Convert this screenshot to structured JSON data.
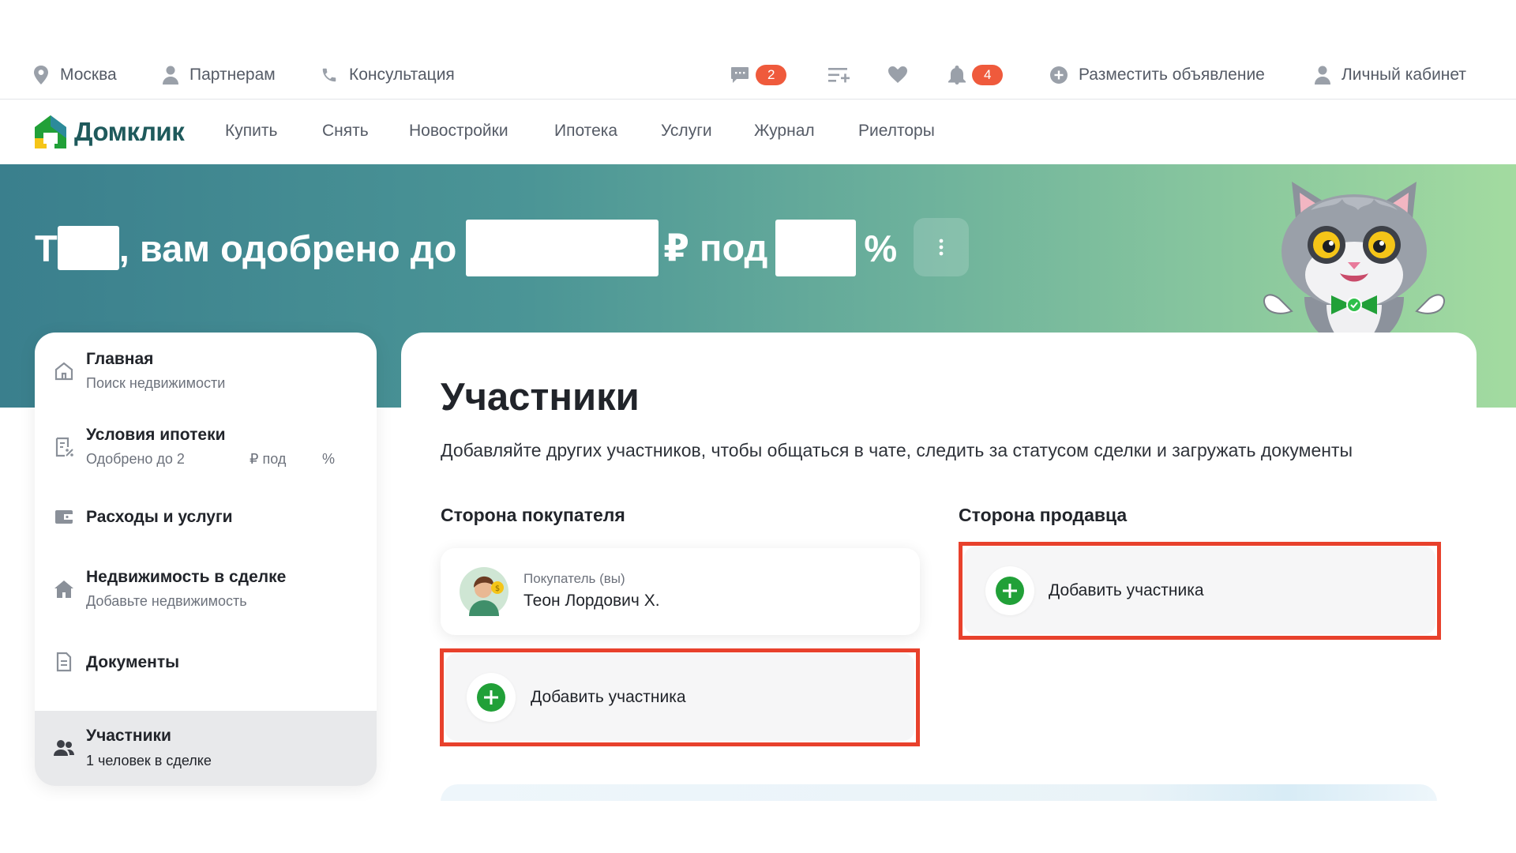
{
  "topbar": {
    "city": "Москва",
    "partners": "Партнерам",
    "consultation": "Консультация",
    "messages_count": "2",
    "notifications_count": "4",
    "post_ad": "Разместить объявление",
    "account": "Личный кабинет"
  },
  "nav": {
    "logo": "Домклик",
    "links": [
      "Купить",
      "Снять",
      "Новостройки",
      "Ипотека",
      "Услуги",
      "Журнал",
      "Риелторы"
    ]
  },
  "hero": {
    "name_initial": "Т",
    "part1": ", вам одобрено до",
    "part2": "₽ под",
    "part3": "%"
  },
  "sidebar": {
    "items": [
      {
        "title": "Главная",
        "subtitle": "Поиск недвижимости"
      },
      {
        "title": "Условия ипотеки",
        "subtitle_a": "Одобрено до 2",
        "subtitle_b": "₽ под",
        "subtitle_c": "%"
      },
      {
        "title": "Расходы и услуги"
      },
      {
        "title": "Недвижимость в сделке",
        "subtitle": "Добавьте недвижимость"
      },
      {
        "title": "Документы"
      },
      {
        "title": "Участники",
        "subtitle": "1 человек в сделке"
      }
    ]
  },
  "main": {
    "title": "Участники",
    "description": "Добавляйте других участников, чтобы общаться в чате, следить за статусом сделки и загружать документы",
    "buyer_side": {
      "title": "Сторона покупателя",
      "participant_role": "Покупатель (вы)",
      "participant_name": "Теон Лордович Х.",
      "add_label": "Добавить участника"
    },
    "seller_side": {
      "title": "Сторона продавца",
      "add_label": "Добавить участника"
    }
  },
  "colors": {
    "accent_green": "#21a038",
    "brand_teal": "#1f5a5c",
    "badge_red": "#ef5a3c",
    "highlight_red": "#e8412c"
  }
}
